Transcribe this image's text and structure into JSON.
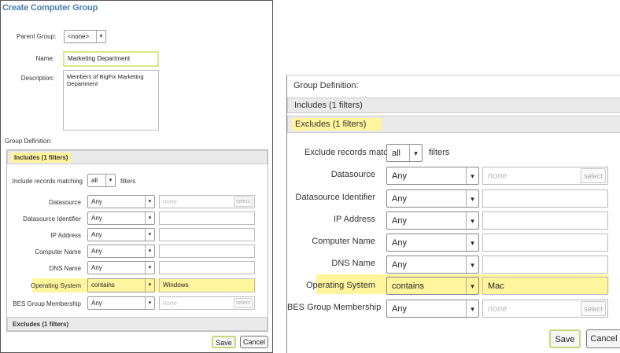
{
  "left": {
    "title": "Create Computer Group",
    "parent_group_label": "Parent Group:",
    "parent_group_value": "<none>",
    "name_label": "Name:",
    "name_value": "Marketing Department",
    "description_label": "Description:",
    "description_value": "Members of BigFix Marketing Department",
    "group_definition_label": "Group Definition:",
    "includes_tab": "Includes (1 filters)",
    "include_matching_label": "Include records matching",
    "include_matching_value": "all",
    "filters_label": "filters",
    "rows": [
      {
        "label": "Datasource",
        "op": "Any",
        "value": "none",
        "has_select": true
      },
      {
        "label": "Datasource Identifier",
        "op": "Any",
        "value": "",
        "has_select": false
      },
      {
        "label": "IP Address",
        "op": "Any",
        "value": "",
        "has_select": false
      },
      {
        "label": "Computer Name",
        "op": "Any",
        "value": "",
        "has_select": false
      },
      {
        "label": "DNS Name",
        "op": "Any",
        "value": "",
        "has_select": false
      },
      {
        "label": "Operating System",
        "op": "contains",
        "value": "Windows",
        "has_select": false
      },
      {
        "label": "BES Group Membership",
        "op": "Any",
        "value": "none",
        "has_select": true
      }
    ],
    "select_label": "select",
    "excludes_tab": "Excludes (1 filters)",
    "save_label": "Save",
    "cancel_label": "Cancel"
  },
  "right": {
    "group_definition_label": "Group Definition:",
    "includes_tab": "Includes (1 filters)",
    "excludes_tab": "Excludes (1 filters)",
    "exclude_matching_label": "Exclude records matching",
    "exclude_matching_value": "all",
    "filters_label": "filters",
    "rows": [
      {
        "label": "Datasource",
        "op": "Any",
        "value": "none",
        "has_select": true
      },
      {
        "label": "Datasource Identifier",
        "op": "Any",
        "value": "",
        "has_select": false
      },
      {
        "label": "IP Address",
        "op": "Any",
        "value": "",
        "has_select": false
      },
      {
        "label": "Computer Name",
        "op": "Any",
        "value": "",
        "has_select": false
      },
      {
        "label": "DNS Name",
        "op": "Any",
        "value": "",
        "has_select": false
      },
      {
        "label": "Operating System",
        "op": "contains",
        "value": "Mac",
        "has_select": false
      },
      {
        "label": "BES Group Membership",
        "op": "Any",
        "value": "none",
        "has_select": true
      }
    ],
    "select_label": "select",
    "save_label": "Save",
    "cancel_label": "Cancel"
  },
  "icons": {
    "dropdown": "chevron-down-icon"
  },
  "colors": {
    "highlight": "#fff59d",
    "title": "#4b7dae"
  }
}
